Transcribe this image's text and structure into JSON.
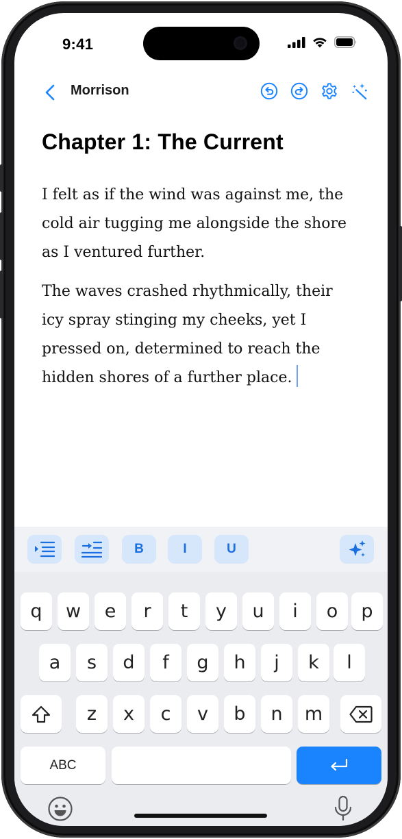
{
  "status_bar": {
    "time": "9:41",
    "icons": [
      "signal-icon",
      "wifi-icon",
      "battery-icon"
    ]
  },
  "nav": {
    "back_icon": "chevron-left-icon",
    "title": "Morrison",
    "actions": [
      "undo-icon",
      "redo-icon",
      "settings-gear-icon",
      "magic-wand-icon"
    ]
  },
  "document": {
    "chapter_title": "Chapter 1: The Current",
    "paragraphs": [
      "I felt as if the wind was against me, the cold air tugging me alongside the shore as I ventured further.",
      "The waves crashed rhythmically, their icy spray stinging my cheeks, yet I pressed on, determined to reach the hidden shores of a further place."
    ]
  },
  "format_bar": {
    "indent_icon": "indent-list-icon",
    "outdent_icon": "outdent-list-icon",
    "bold": "B",
    "italic": "I",
    "underline": "U",
    "ai_icon": "sparkles-icon"
  },
  "keyboard": {
    "row1": [
      "q",
      "w",
      "e",
      "r",
      "t",
      "y",
      "u",
      "i",
      "o",
      "p"
    ],
    "row2": [
      "a",
      "s",
      "d",
      "f",
      "g",
      "h",
      "j",
      "k",
      "l"
    ],
    "row3": [
      "z",
      "x",
      "c",
      "v",
      "b",
      "n",
      "m"
    ],
    "abc_label": "ABC",
    "shift_icon": "shift-icon",
    "delete_icon": "delete-icon",
    "return_icon": "return-icon",
    "emoji_icon": "emoji-icon",
    "mic_icon": "microphone-icon",
    "accent_color": "#1a84ff"
  }
}
